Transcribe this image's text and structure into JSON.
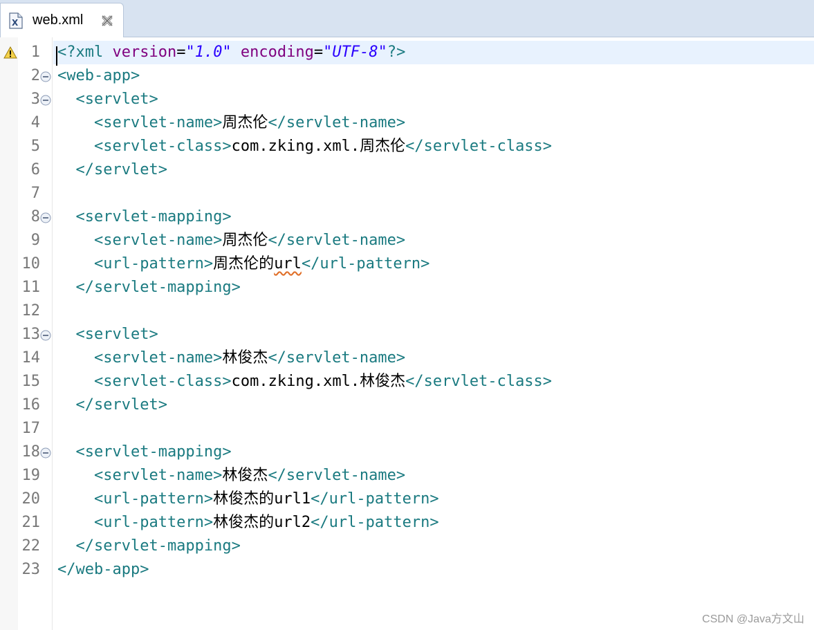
{
  "tab": {
    "label": "web.xml",
    "icon": "xml-file-icon",
    "close_icon": "close-icon"
  },
  "editor": {
    "lines": [
      {
        "n": "1",
        "fold": false,
        "warning": true
      },
      {
        "n": "2",
        "fold": true
      },
      {
        "n": "3",
        "fold": true
      },
      {
        "n": "4",
        "fold": false
      },
      {
        "n": "5",
        "fold": false
      },
      {
        "n": "6",
        "fold": false
      },
      {
        "n": "7",
        "fold": false
      },
      {
        "n": "8",
        "fold": true
      },
      {
        "n": "9",
        "fold": false
      },
      {
        "n": "10",
        "fold": false
      },
      {
        "n": "11",
        "fold": false
      },
      {
        "n": "12",
        "fold": false
      },
      {
        "n": "13",
        "fold": true
      },
      {
        "n": "14",
        "fold": false
      },
      {
        "n": "15",
        "fold": false
      },
      {
        "n": "16",
        "fold": false
      },
      {
        "n": "17",
        "fold": false
      },
      {
        "n": "18",
        "fold": true
      },
      {
        "n": "19",
        "fold": false
      },
      {
        "n": "20",
        "fold": false
      },
      {
        "n": "21",
        "fold": false
      },
      {
        "n": "22",
        "fold": false
      },
      {
        "n": "23",
        "fold": false
      }
    ],
    "code": {
      "l1_open": "<?xml ",
      "l1_attr1": "version",
      "l1_eq1": "=",
      "l1_val1": "\"1.0\"",
      "l1_attr2": " encoding",
      "l1_eq2": "=",
      "l1_val2": "\"UTF-8\"",
      "l1_close": "?>",
      "l2": "<web-app>",
      "l3": "  <servlet>",
      "l4_open": "    <servlet-name>",
      "l4_text": "周杰伦",
      "l4_close": "</servlet-name>",
      "l5_open": "    <servlet-class>",
      "l5_text1": "com.zking.xml.",
      "l5_text2": "周杰伦",
      "l5_close": "</servlet-class>",
      "l6": "  </servlet>",
      "l8": "  <servlet-mapping>",
      "l9_open": "    <servlet-name>",
      "l9_text": "周杰伦",
      "l9_close": "</servlet-name>",
      "l10_open": "    <url-pattern>",
      "l10_text1": "周杰伦的",
      "l10_text2": "url",
      "l10_close": "</url-pattern>",
      "l11": "  </servlet-mapping>",
      "l13": "  <servlet>",
      "l14_open": "    <servlet-name>",
      "l14_text": "林俊杰",
      "l14_close": "</servlet-name>",
      "l15_open": "    <servlet-class>",
      "l15_text1": "com.zking.xml.",
      "l15_text2": "林俊杰",
      "l15_close": "</servlet-class>",
      "l16": "  </servlet>",
      "l18": "  <servlet-mapping>",
      "l19_open": "    <servlet-name>",
      "l19_text": "林俊杰",
      "l19_close": "</servlet-name>",
      "l20_open": "    <url-pattern>",
      "l20_text1": "林俊杰的",
      "l20_text2": "url1",
      "l20_close": "</url-pattern>",
      "l21_open": "    <url-pattern>",
      "l21_text1": "林俊杰的",
      "l21_text2": "url2",
      "l21_close": "</url-pattern>",
      "l22": "  </servlet-mapping>",
      "l23": "</web-app>"
    }
  },
  "watermark": "CSDN @Java方文山",
  "colors": {
    "tag": "#1a7a80",
    "attribute": "#7f007f",
    "value": "#2a00ff",
    "current_line": "#e8f2fe",
    "tab_bar": "#d8e3f1"
  }
}
